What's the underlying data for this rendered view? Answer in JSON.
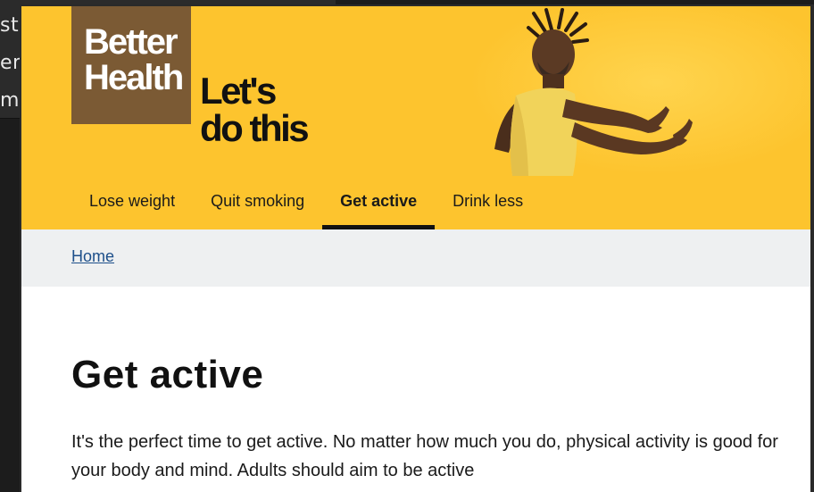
{
  "background_window": {
    "lines": [
      "sta",
      "em",
      "ms"
    ]
  },
  "brand": {
    "logo_line1": "Better",
    "logo_line2": "Health",
    "tagline_line1": "Let's",
    "tagline_line2": "do this",
    "colors": {
      "hero_yellow": "#fdc42e",
      "logo_brown": "#7b5a34",
      "breadcrumb_bg": "#eef0f1",
      "link_blue": "#1d4f8a"
    }
  },
  "nav": {
    "items": [
      {
        "label": "Lose weight",
        "active": false
      },
      {
        "label": "Quit smoking",
        "active": false
      },
      {
        "label": "Get active",
        "active": true
      },
      {
        "label": "Drink less",
        "active": false
      }
    ]
  },
  "breadcrumb": {
    "home": "Home"
  },
  "main": {
    "title": "Get active",
    "intro": "It's the perfect time to get active. No matter how much you do, physical activity is good for your body and mind. Adults should aim to be active"
  }
}
